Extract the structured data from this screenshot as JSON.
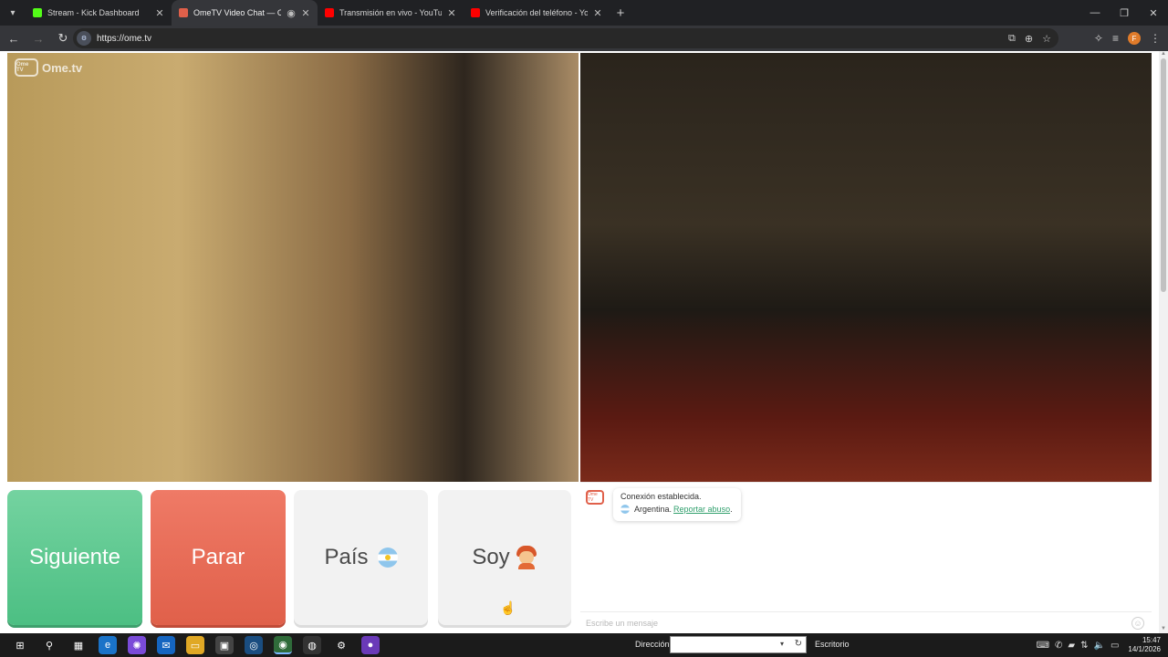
{
  "browser": {
    "tabs": [
      {
        "title": "Stream - Kick Dashboard",
        "favicon_color": "#53fc18",
        "active": false
      },
      {
        "title": "OmeTV Video Chat — Ome",
        "favicon_color": "#e0604a",
        "active": true
      },
      {
        "title": "Transmisión en vivo - YouTube",
        "favicon_color": "#ff0000",
        "active": false
      },
      {
        "title": "Verificación del teléfono - YouT",
        "favicon_color": "#ff0000",
        "active": false
      }
    ],
    "url": "https://ome.tv",
    "profile_initial": "F"
  },
  "page": {
    "logo_text": "Ome.tv",
    "logo_badge": "Ome TV",
    "buttons": {
      "next": "Siguiente",
      "stop": "Parar",
      "country": "País",
      "gender": "Soy"
    },
    "chat": {
      "logo_badge": "Ome TV",
      "status": "Conexión establecida.",
      "country": "Argentina.",
      "report_link": "Reportar abuso",
      "report_suffix": ".",
      "input_placeholder": "Escribe un mensaje"
    }
  },
  "taskbar": {
    "address_label": "Dirección",
    "desktop_label": "Escritorio",
    "time": "15:47",
    "date": "14/1/2026"
  },
  "colors": {
    "next": "#4cbf83",
    "stop": "#e0604a",
    "link": "#2f9f6c"
  }
}
